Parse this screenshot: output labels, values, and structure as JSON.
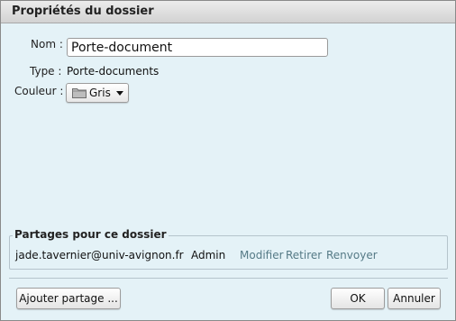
{
  "dialog": {
    "title": "Propriétés du dossier"
  },
  "form": {
    "name_label": "Nom :",
    "name_value": "Porte-document",
    "type_label": "Type :",
    "type_value": "Porte-documents",
    "color_label": "Couleur :",
    "color_value": "Gris",
    "color_icon": "folder-icon",
    "color_swatch": "#b0b0b0"
  },
  "shares": {
    "legend": "Partages pour ce dossier",
    "items": [
      {
        "email": "jade.tavernier@univ-avignon.fr",
        "role": "Admin",
        "actions": [
          "Modifier",
          "Retirer",
          "Renvoyer"
        ]
      }
    ],
    "link_color": "#557a86"
  },
  "buttons": {
    "add_share": "Ajouter partage ...",
    "ok": "OK",
    "cancel": "Annuler"
  }
}
